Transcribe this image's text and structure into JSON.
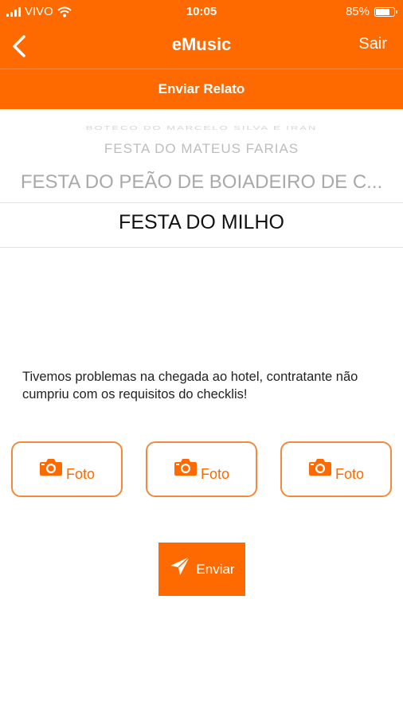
{
  "status_bar": {
    "carrier": "VIVO",
    "time": "10:05",
    "battery": "85%",
    "battery_level": 0.85
  },
  "navbar": {
    "title": "eMusic",
    "right_action": "Sair",
    "back_icon": "chevron-left-icon"
  },
  "subheader": {
    "title": "Enviar Relato"
  },
  "picker": {
    "faded_top": "BOTECO DO MARCELO SILVA E IRAN",
    "items": [
      "FESTA DO MATEUS FARIAS",
      "FESTA DO PEÃO DE BOIADEIRO DE C...",
      "FESTA DO MILHO"
    ],
    "selected": "FESTA DO MILHO"
  },
  "message": "Tivemos problemas na chegada ao hotel, contratante não cumpriu com os requisitos do checklis!",
  "photo_buttons": [
    {
      "label": "Foto",
      "icon": "camera-icon"
    },
    {
      "label": "Foto",
      "icon": "camera-icon"
    },
    {
      "label": "Foto",
      "icon": "camera-icon"
    }
  ],
  "send_button": {
    "label": "Enviar",
    "icon": "paper-plane-icon"
  },
  "colors": {
    "accent": "#ff6a00",
    "button_border": "#f08a3c"
  }
}
